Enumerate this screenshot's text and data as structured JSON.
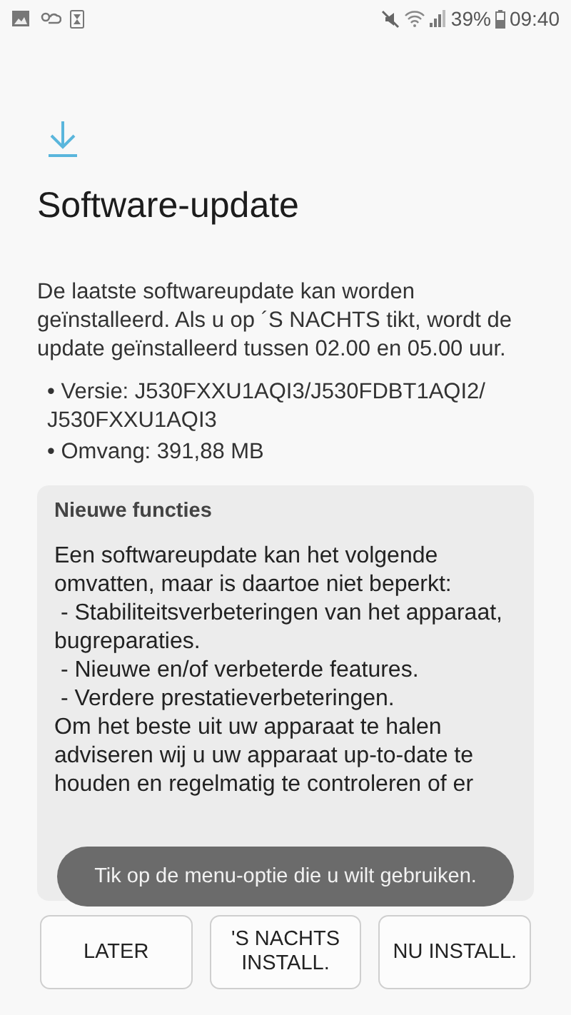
{
  "status_bar": {
    "battery": "39%",
    "time": "09:40"
  },
  "title": "Software-update",
  "description": "De laatste softwareupdate kan worden geïnstalleerd. Als u op ´S NACHTS tikt, wordt de update geïnstalleerd tussen 02.00 en 05.00 uur.",
  "details": [
    "• Versie: J530FXXU1AQI3/J530FDBT1AQI2/ J530FXXU1AQI3",
    "• Omvang: 391,88 MB"
  ],
  "card": {
    "heading": "Nieuwe functies",
    "blocks": [
      {
        "kind": "paragraph",
        "text": "Een softwareupdate kan het volgende omvatten, maar is daartoe niet beperkt:"
      },
      {
        "kind": "bullet",
        "text": " - Stabiliteitsverbeteringen van het apparaat, bugreparaties."
      },
      {
        "kind": "bullet",
        "text": " - Nieuwe en/of verbeterde features."
      },
      {
        "kind": "bullet",
        "text": " - Verdere prestatieverbeteringen."
      },
      {
        "kind": "paragraph",
        "text": "Om het beste uit uw apparaat te halen adviseren wij u uw apparaat up-to-date te houden en regelmatig te controleren of er"
      }
    ]
  },
  "toast": "Tik op de menu-optie die u wilt gebruiken.",
  "buttons": [
    "LATER",
    "'S NACHTS INSTALL.",
    "NU INSTALL."
  ]
}
